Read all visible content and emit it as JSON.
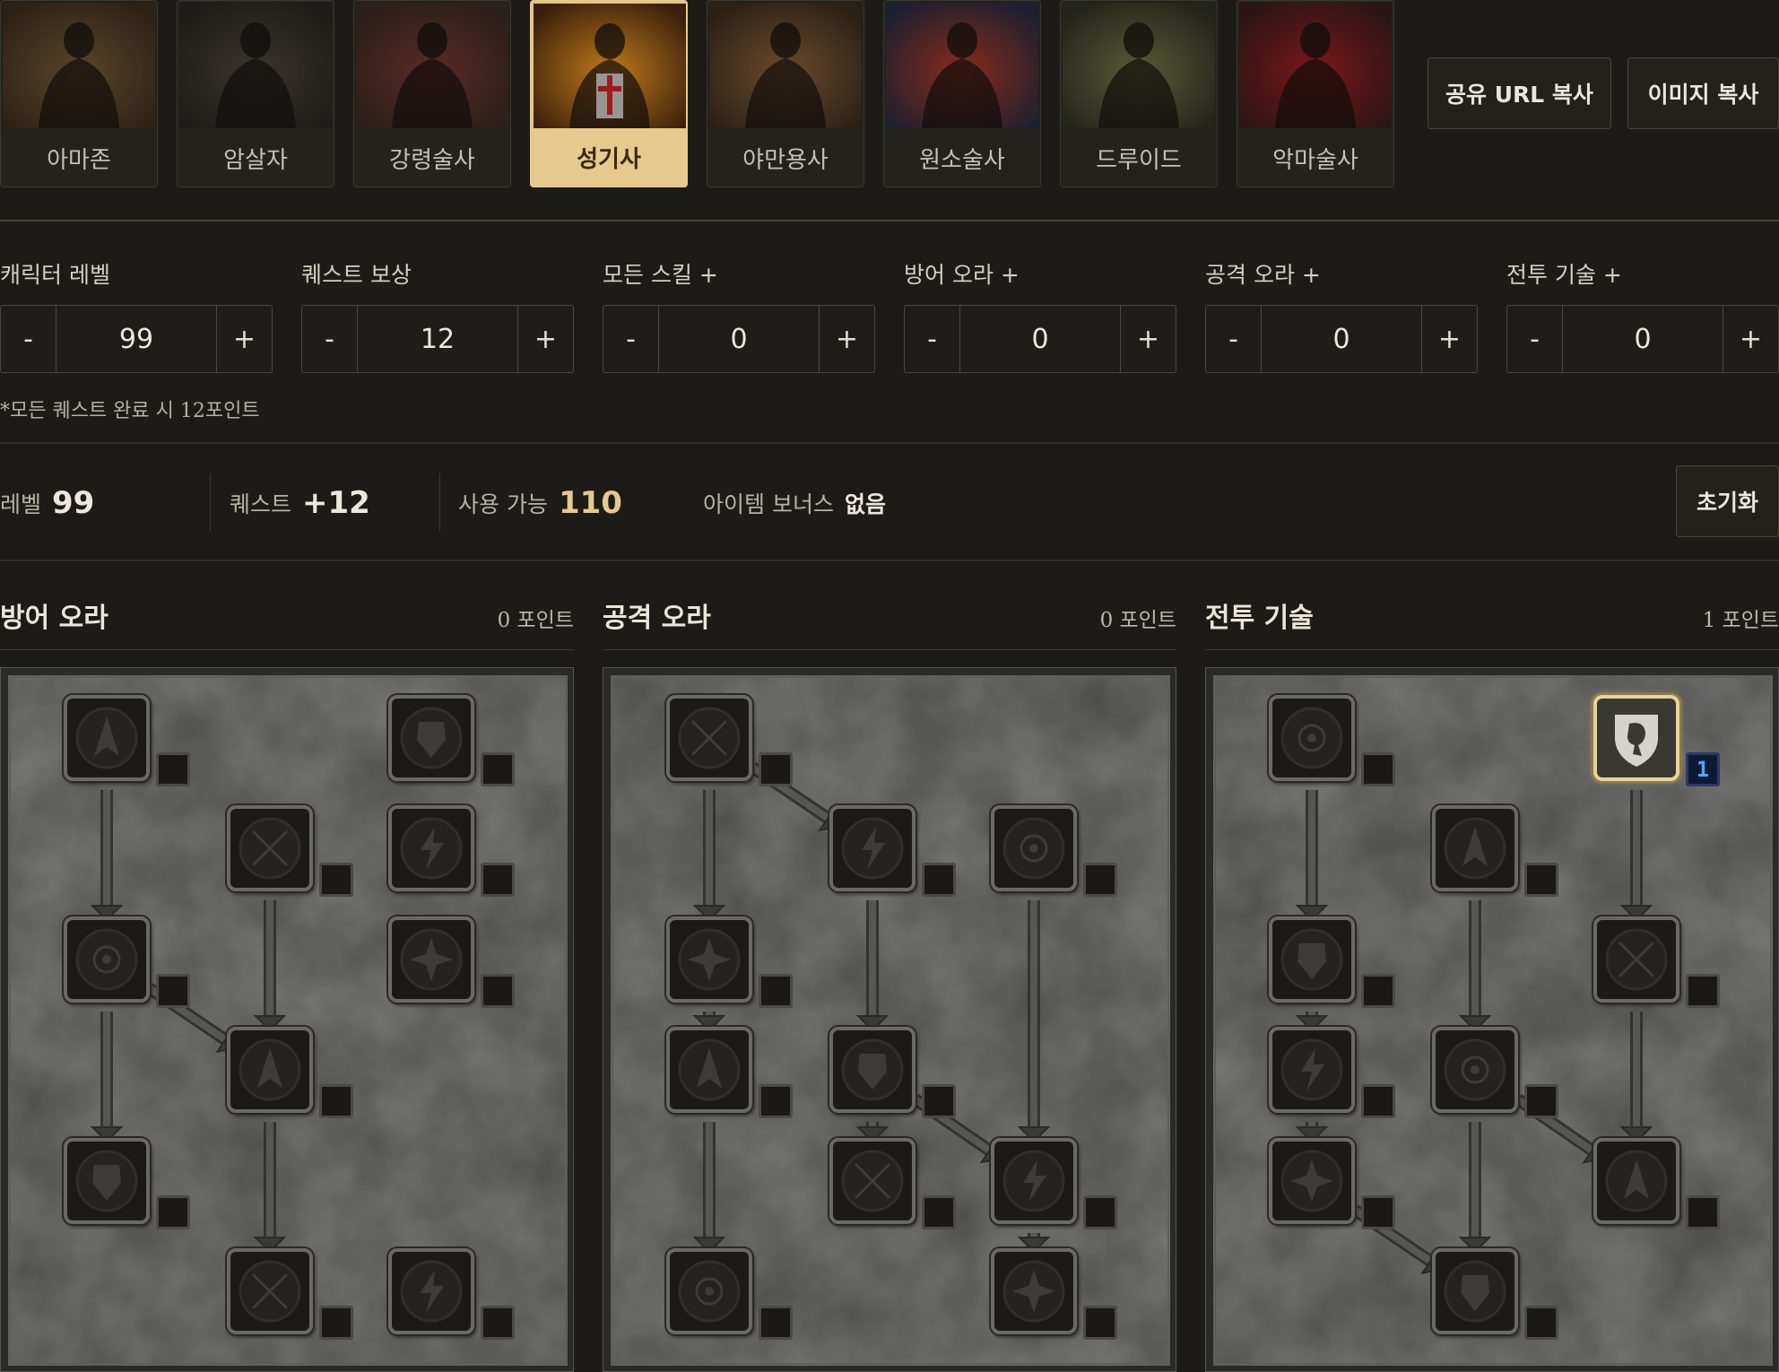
{
  "classes": [
    {
      "label": "아마존",
      "active": false
    },
    {
      "label": "암살자",
      "active": false
    },
    {
      "label": "강령술사",
      "active": false
    },
    {
      "label": "성기사",
      "active": true
    },
    {
      "label": "야만용사",
      "active": false
    },
    {
      "label": "원소술사",
      "active": false
    },
    {
      "label": "드루이드",
      "active": false
    },
    {
      "label": "악마술사",
      "active": false
    }
  ],
  "actions": {
    "share_url": "공유 URL 복사",
    "copy_image": "이미지 복사"
  },
  "steppers": [
    {
      "label": "캐릭터 레벨",
      "value": "99"
    },
    {
      "label": "퀘스트 보상",
      "value": "12"
    },
    {
      "label": "모든 스킬 +",
      "value": "0"
    },
    {
      "label": "방어 오라 +",
      "value": "0"
    },
    {
      "label": "공격 오라 +",
      "value": "0"
    },
    {
      "label": "전투 기술 +",
      "value": "0"
    }
  ],
  "stepper_controls": {
    "minus": "-",
    "plus": "+"
  },
  "quest_note": "*모든 퀘스트 완료 시 12포인트",
  "summary": {
    "level_label": "레벨",
    "level_value": "99",
    "quest_label": "퀘스트",
    "quest_value": "+12",
    "available_label": "사용 가능",
    "available_value": "110",
    "item_bonus_label": "아이템 보너스",
    "item_bonus_value": "없음",
    "reset": "초기화"
  },
  "trees": [
    {
      "title": "방어 오라",
      "points": "0 포인트",
      "skills": [
        {
          "icon": "prayer-icon",
          "points": ""
        },
        {
          "icon": "resist-fire-icon",
          "points": ""
        },
        {
          "icon": "defiance-icon",
          "points": ""
        },
        {
          "icon": "resist-cold-icon",
          "points": ""
        },
        {
          "icon": "cleansing-icon",
          "points": ""
        },
        {
          "icon": "resist-lightning-icon",
          "points": ""
        },
        {
          "icon": "vigor-icon",
          "points": ""
        },
        {
          "icon": "meditation-icon",
          "points": ""
        },
        {
          "icon": "redemption-icon",
          "points": ""
        },
        {
          "icon": "salvation-icon",
          "points": ""
        }
      ]
    },
    {
      "title": "공격 오라",
      "points": "0 포인트",
      "skills": [
        {
          "icon": "might-icon",
          "points": ""
        },
        {
          "icon": "holy-fire-icon",
          "points": ""
        },
        {
          "icon": "thorns-icon",
          "points": ""
        },
        {
          "icon": "blessed-aim-icon",
          "points": ""
        },
        {
          "icon": "concentration-icon",
          "points": ""
        },
        {
          "icon": "holy-freeze-icon",
          "points": ""
        },
        {
          "icon": "holy-shock-icon",
          "points": ""
        },
        {
          "icon": "sanctuary-icon",
          "points": ""
        },
        {
          "icon": "fanaticism-icon",
          "points": ""
        },
        {
          "icon": "conviction-icon",
          "points": ""
        }
      ]
    },
    {
      "title": "전투 기술",
      "points": "1 포인트",
      "skills": [
        {
          "icon": "sacrifice-icon",
          "points": ""
        },
        {
          "icon": "smite-icon",
          "points": "1"
        },
        {
          "icon": "holy-bolt-icon",
          "points": ""
        },
        {
          "icon": "zeal-icon",
          "points": ""
        },
        {
          "icon": "charge-icon",
          "points": ""
        },
        {
          "icon": "vengeance-icon",
          "points": ""
        },
        {
          "icon": "blessed-hammer-icon",
          "points": ""
        },
        {
          "icon": "conversion-icon",
          "points": ""
        },
        {
          "icon": "holy-shield-icon",
          "points": ""
        },
        {
          "icon": "fist-of-the-heavens-icon",
          "points": ""
        }
      ]
    }
  ],
  "colors": {
    "accent": "#e6c98f",
    "point_text": "#4aa8ff",
    "background": "#1d1b17"
  }
}
